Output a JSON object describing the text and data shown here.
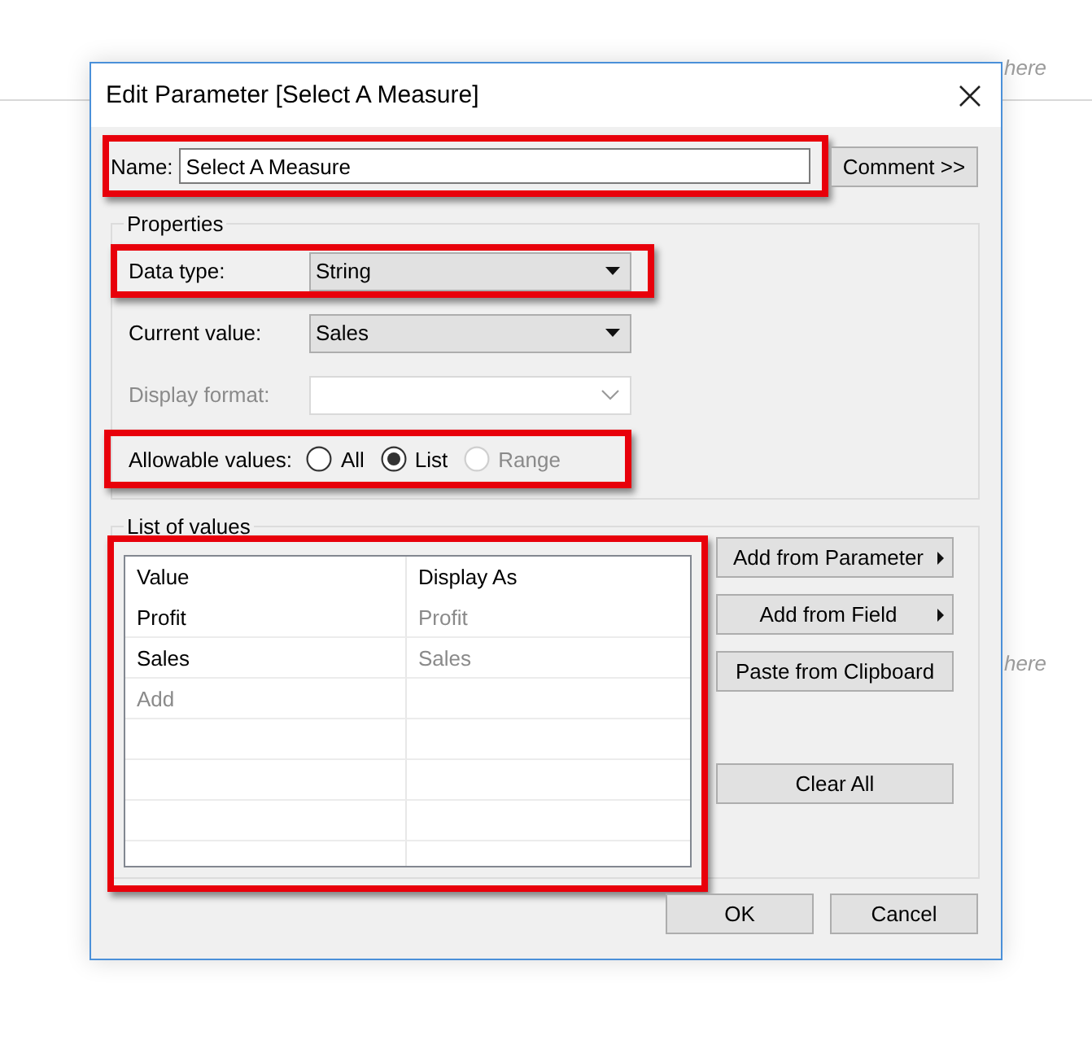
{
  "background": {
    "texts": [
      "here",
      "here"
    ]
  },
  "window": {
    "title": "Edit Parameter [Select A Measure]"
  },
  "name_field": {
    "label": "Name:",
    "value": "Select A Measure",
    "highlighted": true
  },
  "comment_button": "Comment >>",
  "properties": {
    "title": "Properties",
    "rows": [
      {
        "kind": "dropdown",
        "label": "Data type:",
        "value": "String",
        "disabled": false,
        "highlighted": true
      },
      {
        "kind": "dropdown",
        "label": "Current value:",
        "value": "Sales",
        "disabled": false,
        "highlighted": false
      },
      {
        "kind": "dropdown",
        "label": "Display format:",
        "disabled": true,
        "highlighted": false
      },
      {
        "kind": "radios",
        "label": "Allowable values:",
        "highlighted": true,
        "options": [
          {
            "label": "All",
            "selected": false,
            "disabled": false
          },
          {
            "label": "List",
            "selected": true,
            "disabled": false
          },
          {
            "label": "Range",
            "selected": false,
            "disabled": true
          }
        ]
      }
    ]
  },
  "list_of_values": {
    "title": "List of values",
    "highlighted": true,
    "columns": [
      "Value",
      "Display As"
    ],
    "rows": [
      {
        "value": "Profit",
        "display_as": "Profit"
      },
      {
        "value": "Sales",
        "display_as": "Sales"
      }
    ],
    "add_placeholder": "Add",
    "buttons": [
      {
        "label": "Add from Parameter",
        "submenu": true
      },
      {
        "label": "Add from Field",
        "submenu": true
      },
      {
        "label": "Paste from Clipboard",
        "submenu": false
      }
    ],
    "clear_button": "Clear All"
  },
  "dialog_buttons": [
    "OK",
    "Cancel"
  ]
}
